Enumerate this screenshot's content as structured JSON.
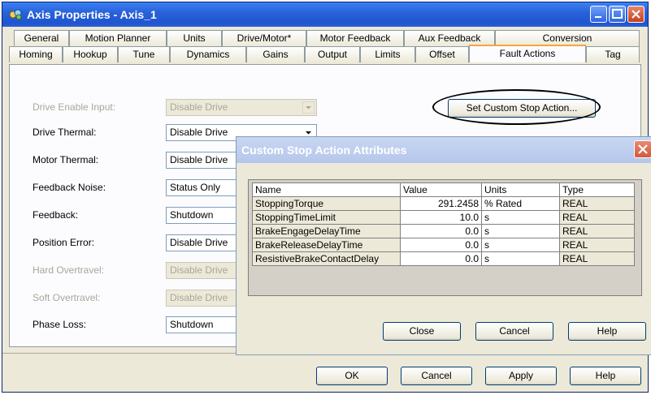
{
  "window": {
    "title": "Axis Properties - Axis_1"
  },
  "tabs": {
    "row1": [
      "General",
      "Motion Planner",
      "Units",
      "Drive/Motor*",
      "Motor Feedback",
      "Aux Feedback",
      "Conversion"
    ],
    "row2": [
      "Homing",
      "Hookup",
      "Tune",
      "Dynamics",
      "Gains",
      "Output",
      "Limits",
      "Offset",
      "Fault Actions",
      "Tag"
    ],
    "active": "Fault Actions"
  },
  "fault_actions": {
    "drive_enable_input": {
      "label": "Drive Enable Input:",
      "value": "Disable Drive"
    },
    "drive_thermal": {
      "label": "Drive Thermal:",
      "value": "Disable Drive"
    },
    "motor_thermal": {
      "label": "Motor Thermal:",
      "value": "Disable Drive"
    },
    "feedback_noise": {
      "label": "Feedback Noise:",
      "value": "Status Only"
    },
    "feedback": {
      "label": "Feedback:",
      "value": "Shutdown"
    },
    "position_error": {
      "label": "Position Error:",
      "value": "Disable Drive"
    },
    "hard_overtravel": {
      "label": "Hard Overtravel:",
      "value": "Disable Drive"
    },
    "soft_overtravel": {
      "label": "Soft Overtravel:",
      "value": "Disable Drive"
    },
    "phase_loss": {
      "label": "Phase Loss:",
      "value": "Shutdown"
    },
    "set_custom_stop_label": "Set Custom Stop Action..."
  },
  "dialog": {
    "title": "Custom Stop Action Attributes",
    "columns": [
      "Name",
      "Value",
      "Units",
      "Type"
    ],
    "rows": [
      {
        "name": "StoppingTorque",
        "value": "291.2458",
        "units": "% Rated",
        "type": "REAL"
      },
      {
        "name": "StoppingTimeLimit",
        "value": "10.0",
        "units": "s",
        "type": "REAL"
      },
      {
        "name": "BrakeEngageDelayTime",
        "value": "0.0",
        "units": "s",
        "type": "REAL"
      },
      {
        "name": "BrakeReleaseDelayTime",
        "value": "0.0",
        "units": "s",
        "type": "REAL"
      },
      {
        "name": "ResistiveBrakeContactDelay",
        "value": "0.0",
        "units": "s",
        "type": "REAL"
      }
    ],
    "close_label": "Close",
    "cancel_label": "Cancel",
    "help_label": "Help"
  },
  "footer": {
    "ok_label": "OK",
    "cancel_label": "Cancel",
    "apply_label": "Apply",
    "help_label": "Help"
  }
}
